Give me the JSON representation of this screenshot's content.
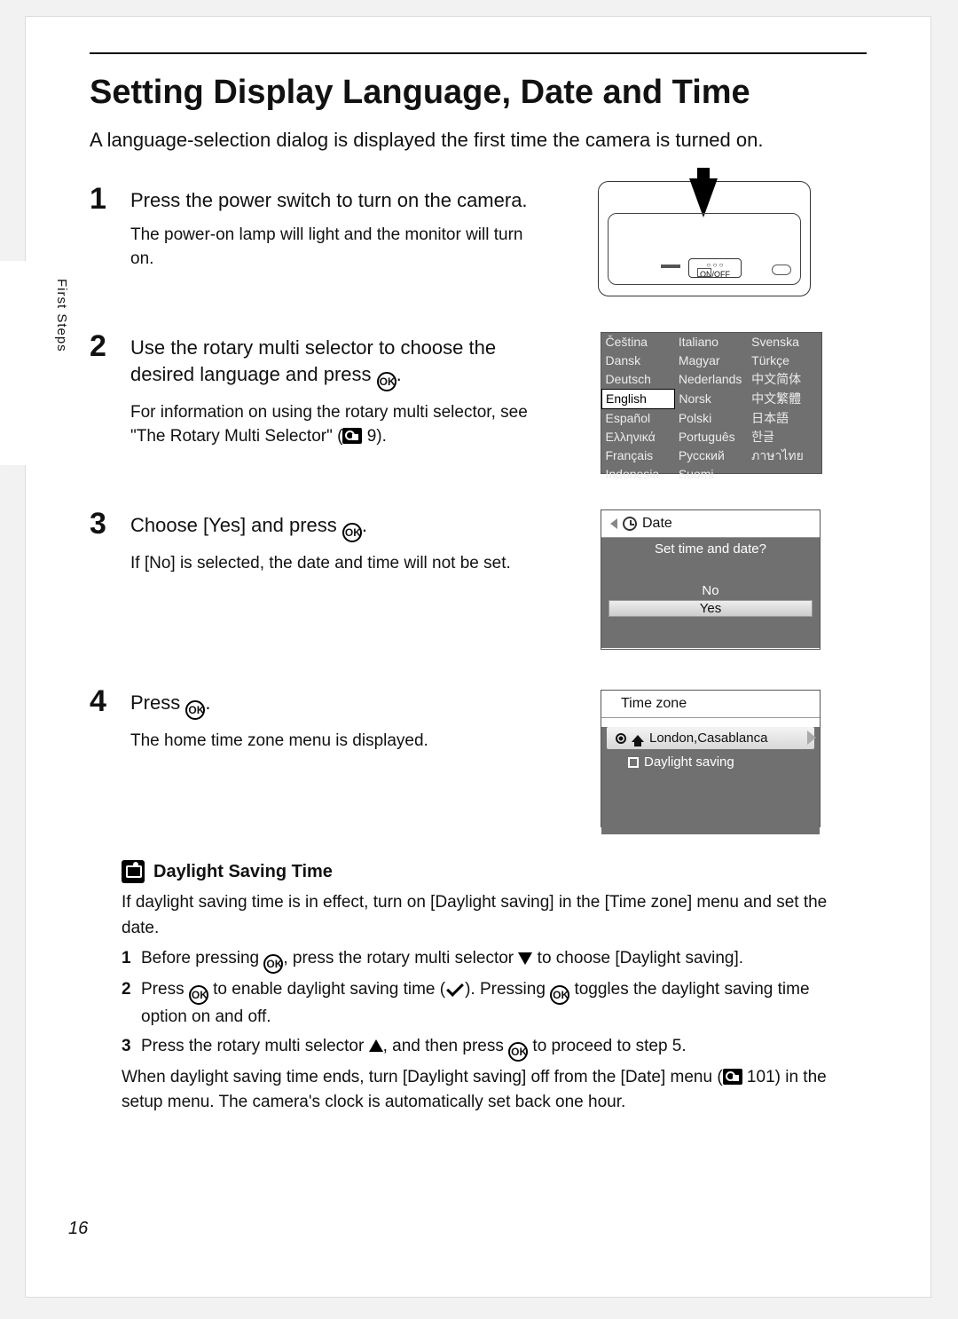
{
  "side_tab": "First Steps",
  "title": "Setting Display Language, Date and Time",
  "intro": "A language-selection dialog is displayed the first time the camera is turned on.",
  "steps": [
    {
      "num": "1",
      "head": "Press the power switch to turn on the camera.",
      "body": "The power-on lamp will light and the monitor will turn on."
    },
    {
      "num": "2",
      "head_a": "Use the rotary multi selector to choose the desired language and press ",
      "head_b": ".",
      "body_a": "For information on using the rotary multi selector, see \"The Rotary Multi Selector\" (",
      "body_b": " 9)."
    },
    {
      "num": "3",
      "head_a": "Choose [Yes] and press ",
      "head_b": ".",
      "body": "If [No] is selected, the date and time will not be set."
    },
    {
      "num": "4",
      "head_a": "Press ",
      "head_b": ".",
      "body": "The home time zone menu is displayed."
    }
  ],
  "camera_switch": "ON/OFF",
  "lang_screen": {
    "rows": [
      [
        "Čeština",
        "Italiano",
        "Svenska"
      ],
      [
        "Dansk",
        "Magyar",
        "Türkçe"
      ],
      [
        "Deutsch",
        "Nederlands",
        "中文简体"
      ],
      [
        "English",
        "Norsk",
        "中文繁體"
      ],
      [
        "Español",
        "Polski",
        "日本語"
      ],
      [
        "Ελληνικά",
        "Português",
        "한글"
      ],
      [
        "Français",
        "Русский",
        "ภาษาไทย"
      ],
      [
        "Indonesia",
        "Suomi",
        ""
      ]
    ],
    "selected": "English"
  },
  "date_screen": {
    "title": "Date",
    "question": "Set time and date?",
    "no": "No",
    "yes": "Yes"
  },
  "tz_screen": {
    "title": "Time zone",
    "zone": "London,Casablanca",
    "dst": "Daylight saving"
  },
  "note": {
    "title": "Daylight Saving Time",
    "p1": "If daylight saving time is in effect, turn on [Daylight saving] in the [Time zone] menu and set the date.",
    "i1a": "Before pressing ",
    "i1b": ", press the rotary multi selector ",
    "i1c": " to choose [Daylight saving].",
    "i2a": "Press ",
    "i2b": " to enable daylight saving time (",
    "i2c": "). Pressing ",
    "i2d": " toggles the daylight saving time option on and off.",
    "i3a": "Press the rotary multi selector ",
    "i3b": ", and then press ",
    "i3c": " to proceed to step 5.",
    "p2a": "When daylight saving time ends, turn [Daylight saving] off from the [Date] menu (",
    "p2b": " 101) in the setup menu. The camera's clock is automatically set back one hour."
  },
  "page_no": "16",
  "ok": "OK"
}
